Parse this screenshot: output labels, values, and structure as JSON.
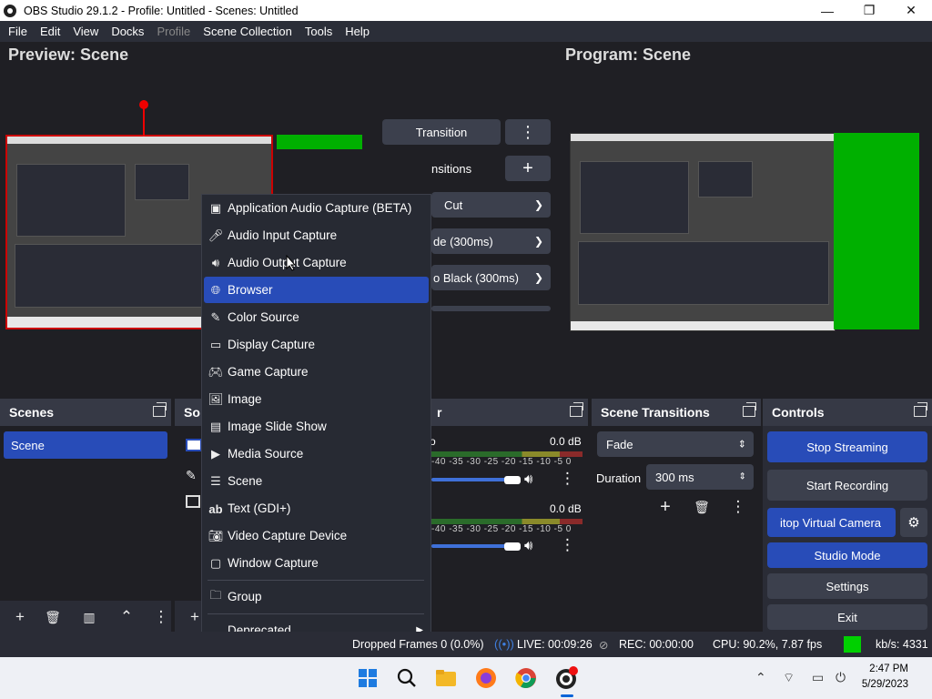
{
  "window": {
    "title": "OBS Studio 29.1.2 - Profile: Untitled - Scenes: Untitled",
    "minimize": "—",
    "maximize": "❐",
    "close": "✕"
  },
  "menu": {
    "items": [
      "File",
      "Edit",
      "View",
      "Docks",
      "Profile",
      "Scene Collection",
      "Tools",
      "Help"
    ]
  },
  "preview": {
    "label": "Preview: Scene"
  },
  "program": {
    "label": "Program: Scene"
  },
  "transition_panel": {
    "transition_button": "Transition",
    "quick_transitions_label": "nsitions",
    "cut_label": "Cut",
    "fade_label": "de (300ms)",
    "fade_black_label": "o Black (300ms)"
  },
  "docks": {
    "scenes": {
      "title": "Scenes",
      "items": [
        "Scene"
      ]
    },
    "sources": {
      "title": "So"
    },
    "mixer": {
      "title": "r",
      "tracks": [
        {
          "name": "o",
          "db": "0.0 dB"
        },
        {
          "name": "",
          "db": "0.0 dB"
        }
      ],
      "ticks": "-40 -35 -30 -25 -20 -15 -10 -5 0"
    },
    "scene_transitions": {
      "title": "Scene Transitions",
      "transition": "Fade",
      "duration_label": "Duration",
      "duration_value": "300 ms"
    },
    "controls": {
      "title": "Controls",
      "stop_streaming": "Stop Streaming",
      "start_recording": "Start Recording",
      "stop_virtual_camera": "itop Virtual Camera",
      "studio_mode": "Studio Mode",
      "settings": "Settings",
      "exit": "Exit"
    }
  },
  "context_menu": {
    "items": [
      {
        "label": "Application Audio Capture (BETA)",
        "icon": "app-audio-icon"
      },
      {
        "label": "Audio Input Capture",
        "icon": "microphone-icon"
      },
      {
        "label": "Audio Output Capture",
        "icon": "speaker-icon"
      },
      {
        "label": "Browser",
        "icon": "globe-icon"
      },
      {
        "label": "Color Source",
        "icon": "paintbrush-icon"
      },
      {
        "label": "Display Capture",
        "icon": "monitor-icon"
      },
      {
        "label": "Game Capture",
        "icon": "gamepad-icon"
      },
      {
        "label": "Image",
        "icon": "image-icon"
      },
      {
        "label": "Image Slide Show",
        "icon": "slideshow-icon"
      },
      {
        "label": "Media Source",
        "icon": "play-icon"
      },
      {
        "label": "Scene",
        "icon": "list-icon"
      },
      {
        "label": "Text (GDI+)",
        "icon": "text-icon"
      },
      {
        "label": "Video Capture Device",
        "icon": "camera-icon"
      },
      {
        "label": "Window Capture",
        "icon": "window-icon"
      }
    ],
    "group": "Group",
    "deprecated": "Deprecated",
    "highlighted": "Browser"
  },
  "status": {
    "dropped_frames": "Dropped Frames 0 (0.0%)",
    "live": "LIVE: 00:09:26",
    "rec": "REC: 00:00:00",
    "cpu": "CPU: 90.2%, 7.87 fps",
    "kbps": "kb/s: 4331"
  },
  "taskbar": {
    "time": "2:47 PM",
    "date": "5/29/2023"
  }
}
